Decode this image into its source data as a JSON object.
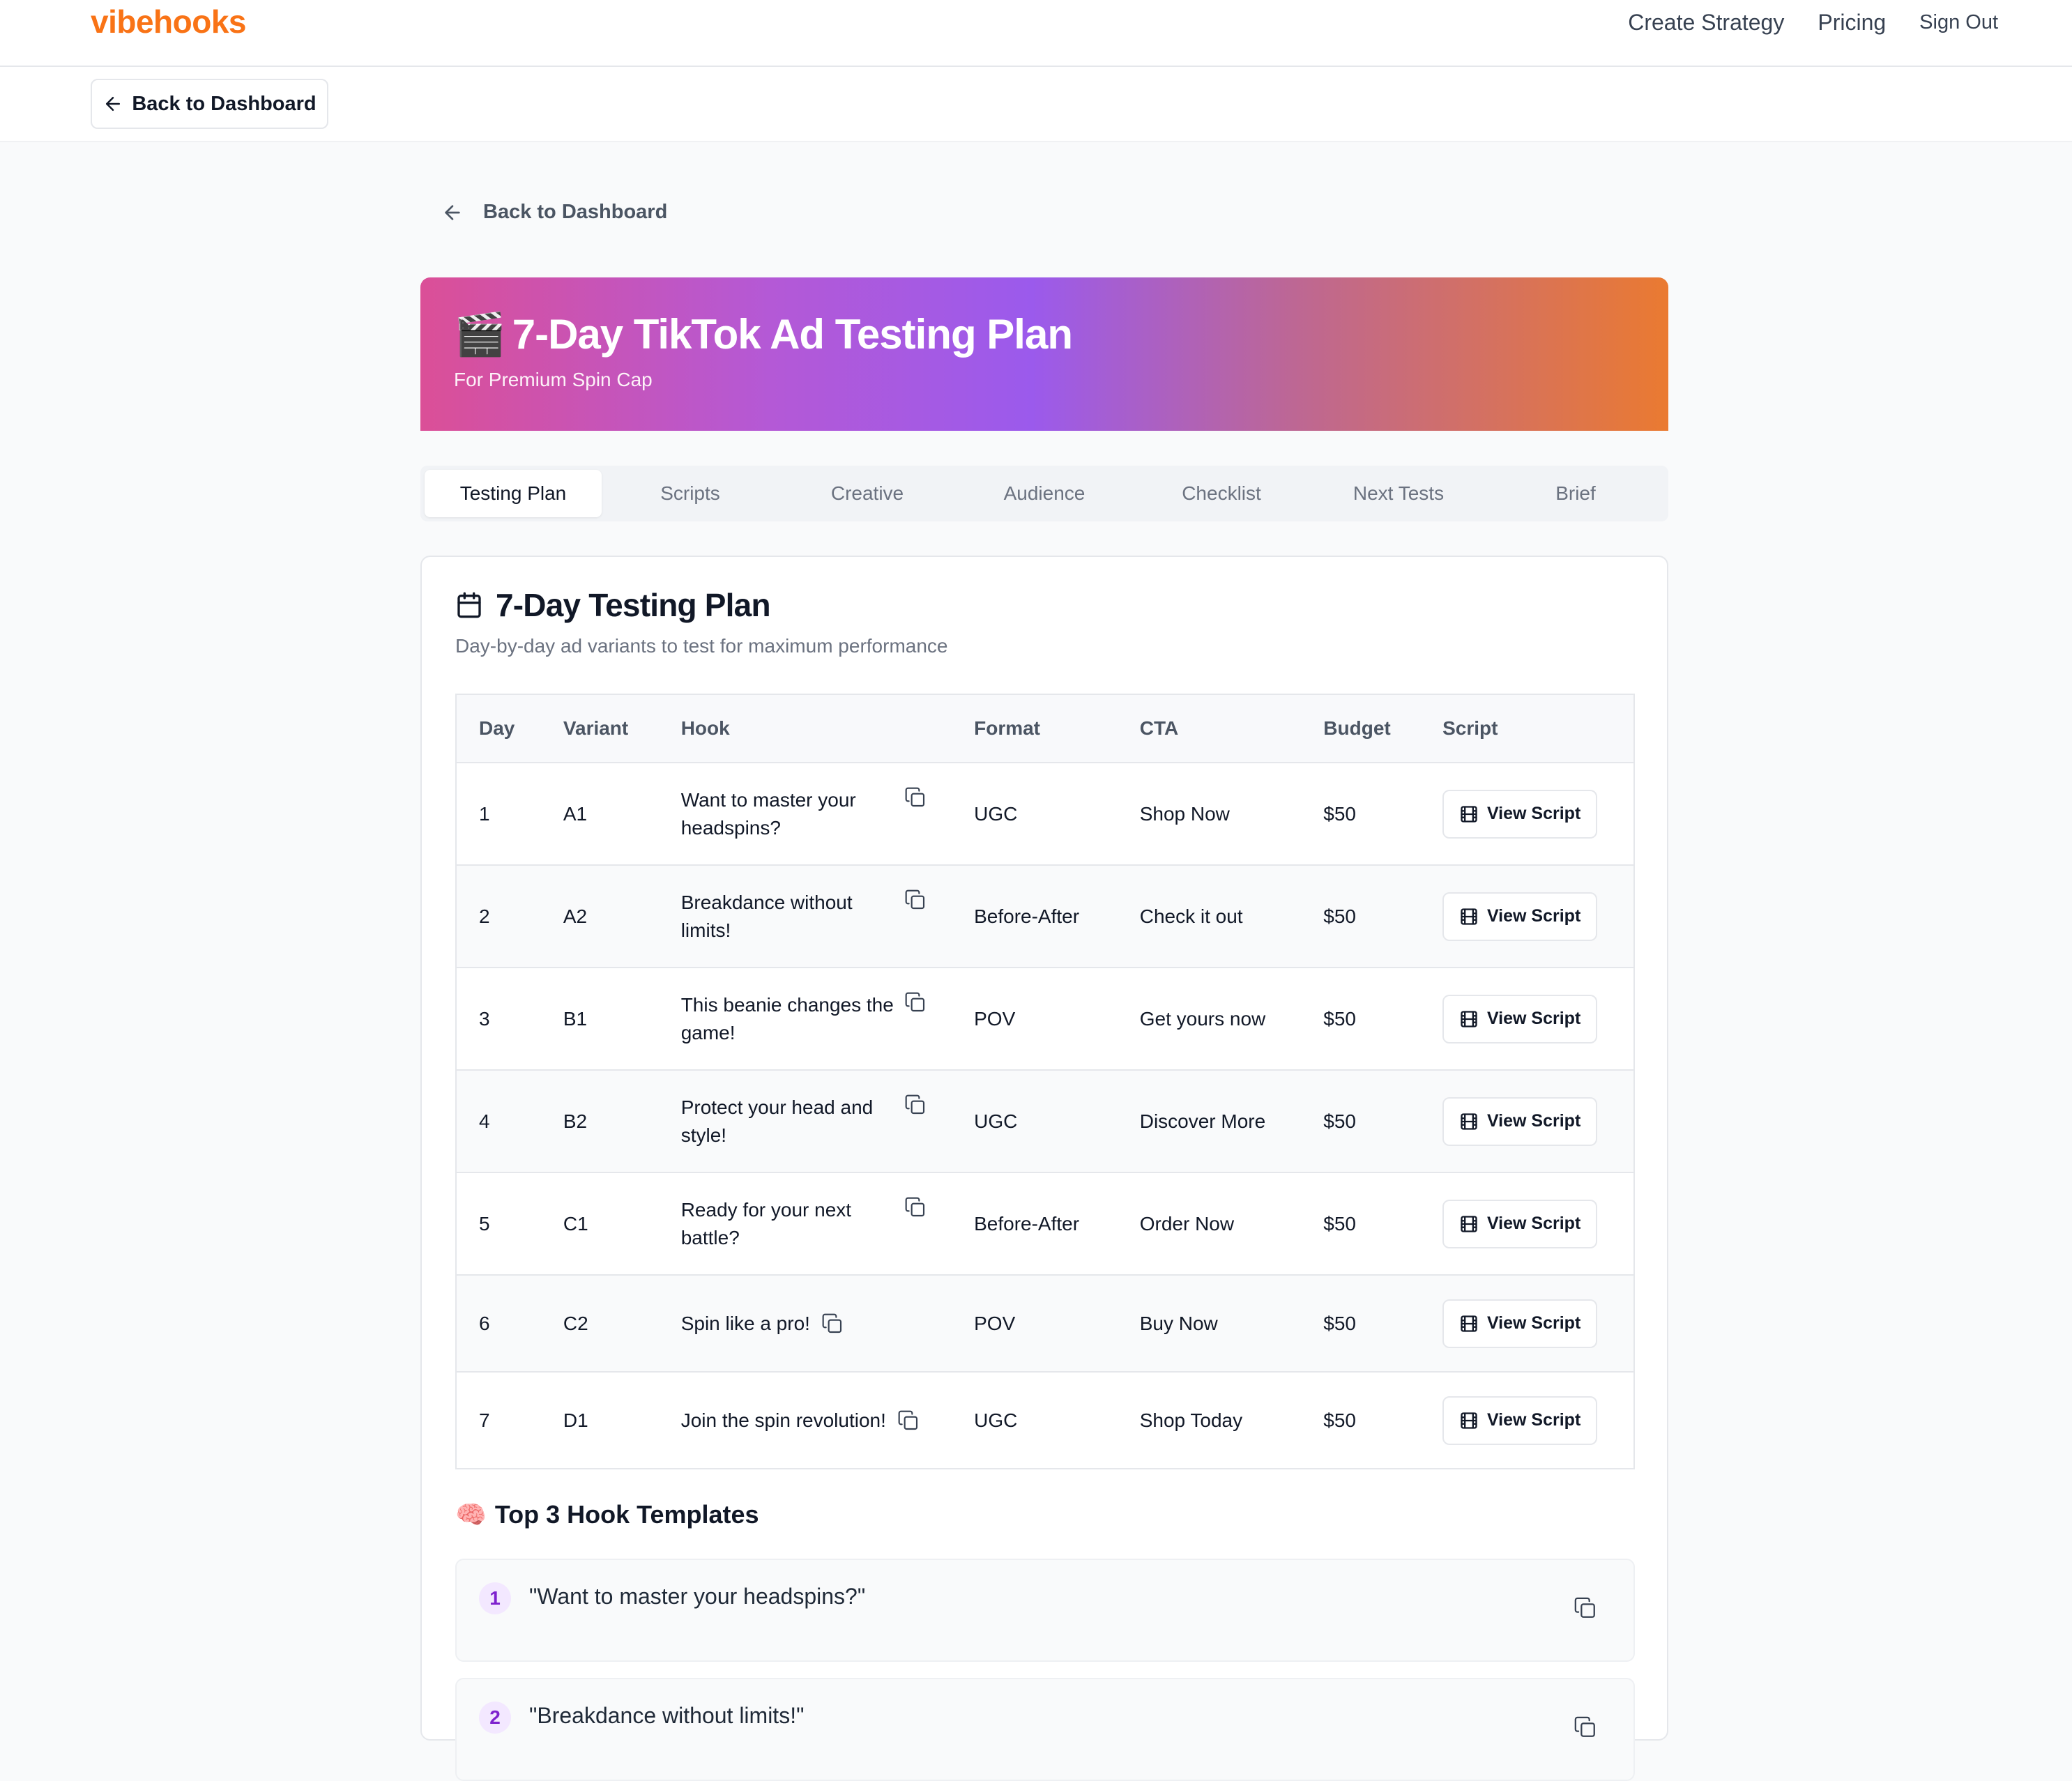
{
  "nav": {
    "logo": "vibehooks",
    "links": [
      "Create Strategy",
      "Pricing",
      "Sign Out"
    ]
  },
  "subbar": {
    "back_label": "Back to Dashboard"
  },
  "content": {
    "back_label": "Back to Dashboard"
  },
  "hero": {
    "emoji": "🎬",
    "title": "7-Day TikTok Ad Testing Plan",
    "subtitle": "For Premium Spin Cap",
    "gradient_colors": [
      "#db4f97",
      "#9b5aec",
      "#ea7a31"
    ]
  },
  "tabs": [
    "Testing Plan",
    "Scripts",
    "Creative",
    "Audience",
    "Checklist",
    "Next Tests",
    "Brief"
  ],
  "active_tab": "Testing Plan",
  "plan": {
    "title": "7-Day Testing Plan",
    "subtitle": "Day-by-day ad variants to test for maximum performance",
    "columns": [
      "Day",
      "Variant",
      "Hook",
      "Format",
      "CTA",
      "Budget",
      "Script"
    ],
    "rows": [
      {
        "day": "1",
        "variant": "A1",
        "hook": "Want to master your headspins?",
        "format": "UGC",
        "cta": "Shop Now",
        "budget": "$50",
        "script": "View Script"
      },
      {
        "day": "2",
        "variant": "A2",
        "hook": "Breakdance without limits!",
        "format": "Before-After",
        "cta": "Check it out",
        "budget": "$50",
        "script": "View Script"
      },
      {
        "day": "3",
        "variant": "B1",
        "hook": "This beanie changes the game!",
        "format": "POV",
        "cta": "Get yours now",
        "budget": "$50",
        "script": "View Script"
      },
      {
        "day": "4",
        "variant": "B2",
        "hook": "Protect your head and style!",
        "format": "UGC",
        "cta": "Discover More",
        "budget": "$50",
        "script": "View Script"
      },
      {
        "day": "5",
        "variant": "C1",
        "hook": "Ready for your next battle?",
        "format": "Before-After",
        "cta": "Order Now",
        "budget": "$50",
        "script": "View Script"
      },
      {
        "day": "6",
        "variant": "C2",
        "hook": "Spin like a pro!",
        "format": "POV",
        "cta": "Buy Now",
        "budget": "$50",
        "script": "View Script"
      },
      {
        "day": "7",
        "variant": "D1",
        "hook": "Join the spin revolution!",
        "format": "UGC",
        "cta": "Shop Today",
        "budget": "$50",
        "script": "View Script"
      }
    ]
  },
  "templates": {
    "emoji": "🧠",
    "title": "Top 3 Hook Templates",
    "items": [
      {
        "num": "1",
        "text": "\"Want to master your headspins?\""
      },
      {
        "num": "2",
        "text": "\"Breakdance without limits!\""
      }
    ]
  },
  "colors": {
    "brand": "#f97316",
    "variant": "#9333ea"
  },
  "icons": {
    "back": "arrow-left-icon",
    "calendar": "calendar-icon",
    "copy": "copy-icon",
    "script": "film-icon"
  }
}
